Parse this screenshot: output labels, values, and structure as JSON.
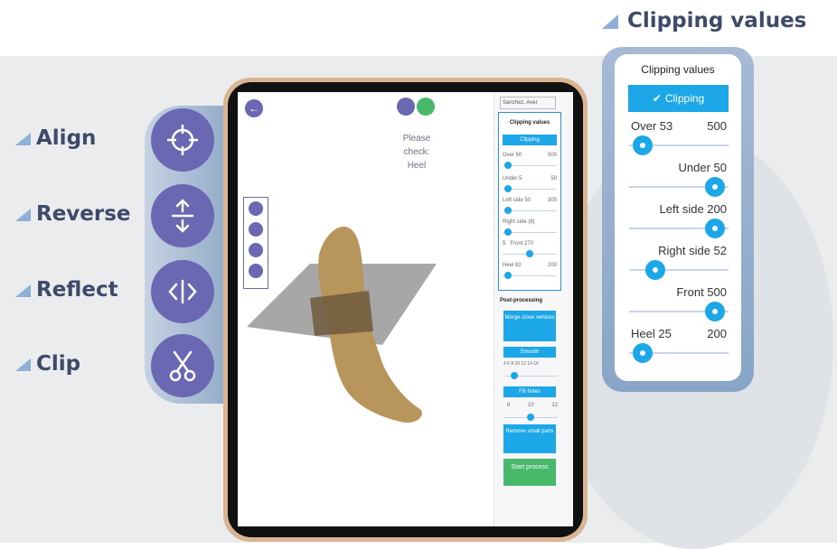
{
  "heading": {
    "text": "Clipping values"
  },
  "features": [
    {
      "label": "Align",
      "icon": "crosshair-icon"
    },
    {
      "label": "Reverse",
      "icon": "arrows-up-down-icon"
    },
    {
      "label": "Reflect",
      "icon": "reflect-icon"
    },
    {
      "label": "Clip",
      "icon": "scissors-icon"
    }
  ],
  "tablet": {
    "check_lines": [
      "Please",
      "check:",
      "Heel"
    ],
    "select_value": "Sanchez, Aver",
    "mini_panel": {
      "title": "Clipping values",
      "clip_button": "Clipping",
      "rows": [
        {
          "label": "Over 50",
          "max": "500"
        },
        {
          "label": "Under 5",
          "max": "50"
        },
        {
          "label": "Left side 50",
          "max": "300"
        },
        {
          "label": "Right side (8)",
          "max": ""
        },
        {
          "label": "5",
          "mid": "Front 270",
          "max": ""
        },
        {
          "label": "Heel 82",
          "max": "200"
        }
      ]
    },
    "post_processing": {
      "title": "Post-processing",
      "merge": "Merge close vertices",
      "smooth": "Smooth",
      "smooth_scale": "4 6 8 10 12 14 16",
      "fill_holes": "Fill holes",
      "fill_scale": [
        "8",
        "10",
        "12"
      ],
      "remove": "Remove small parts",
      "start": "Start process"
    }
  },
  "card": {
    "title": "Clipping values",
    "clip_button": "Clipping",
    "check_glyph": "✔",
    "sliders": [
      {
        "label": "Over 53",
        "max": "500",
        "level": 0.05
      },
      {
        "label": "Under 50",
        "max": "",
        "level": 0.95
      },
      {
        "label": "Left side 200",
        "max": "",
        "level": 0.95
      },
      {
        "label": "Right side 52",
        "max": "",
        "level": 0.2
      },
      {
        "label": "Front 500",
        "max": "",
        "level": 0.95
      },
      {
        "label": "Heel 25",
        "max": "200",
        "level": 0.05
      }
    ]
  },
  "colors": {
    "accent": "#1ba7e8",
    "tool": "#6a68b3",
    "heading": "#3d4a6a",
    "start": "#48b86a"
  }
}
